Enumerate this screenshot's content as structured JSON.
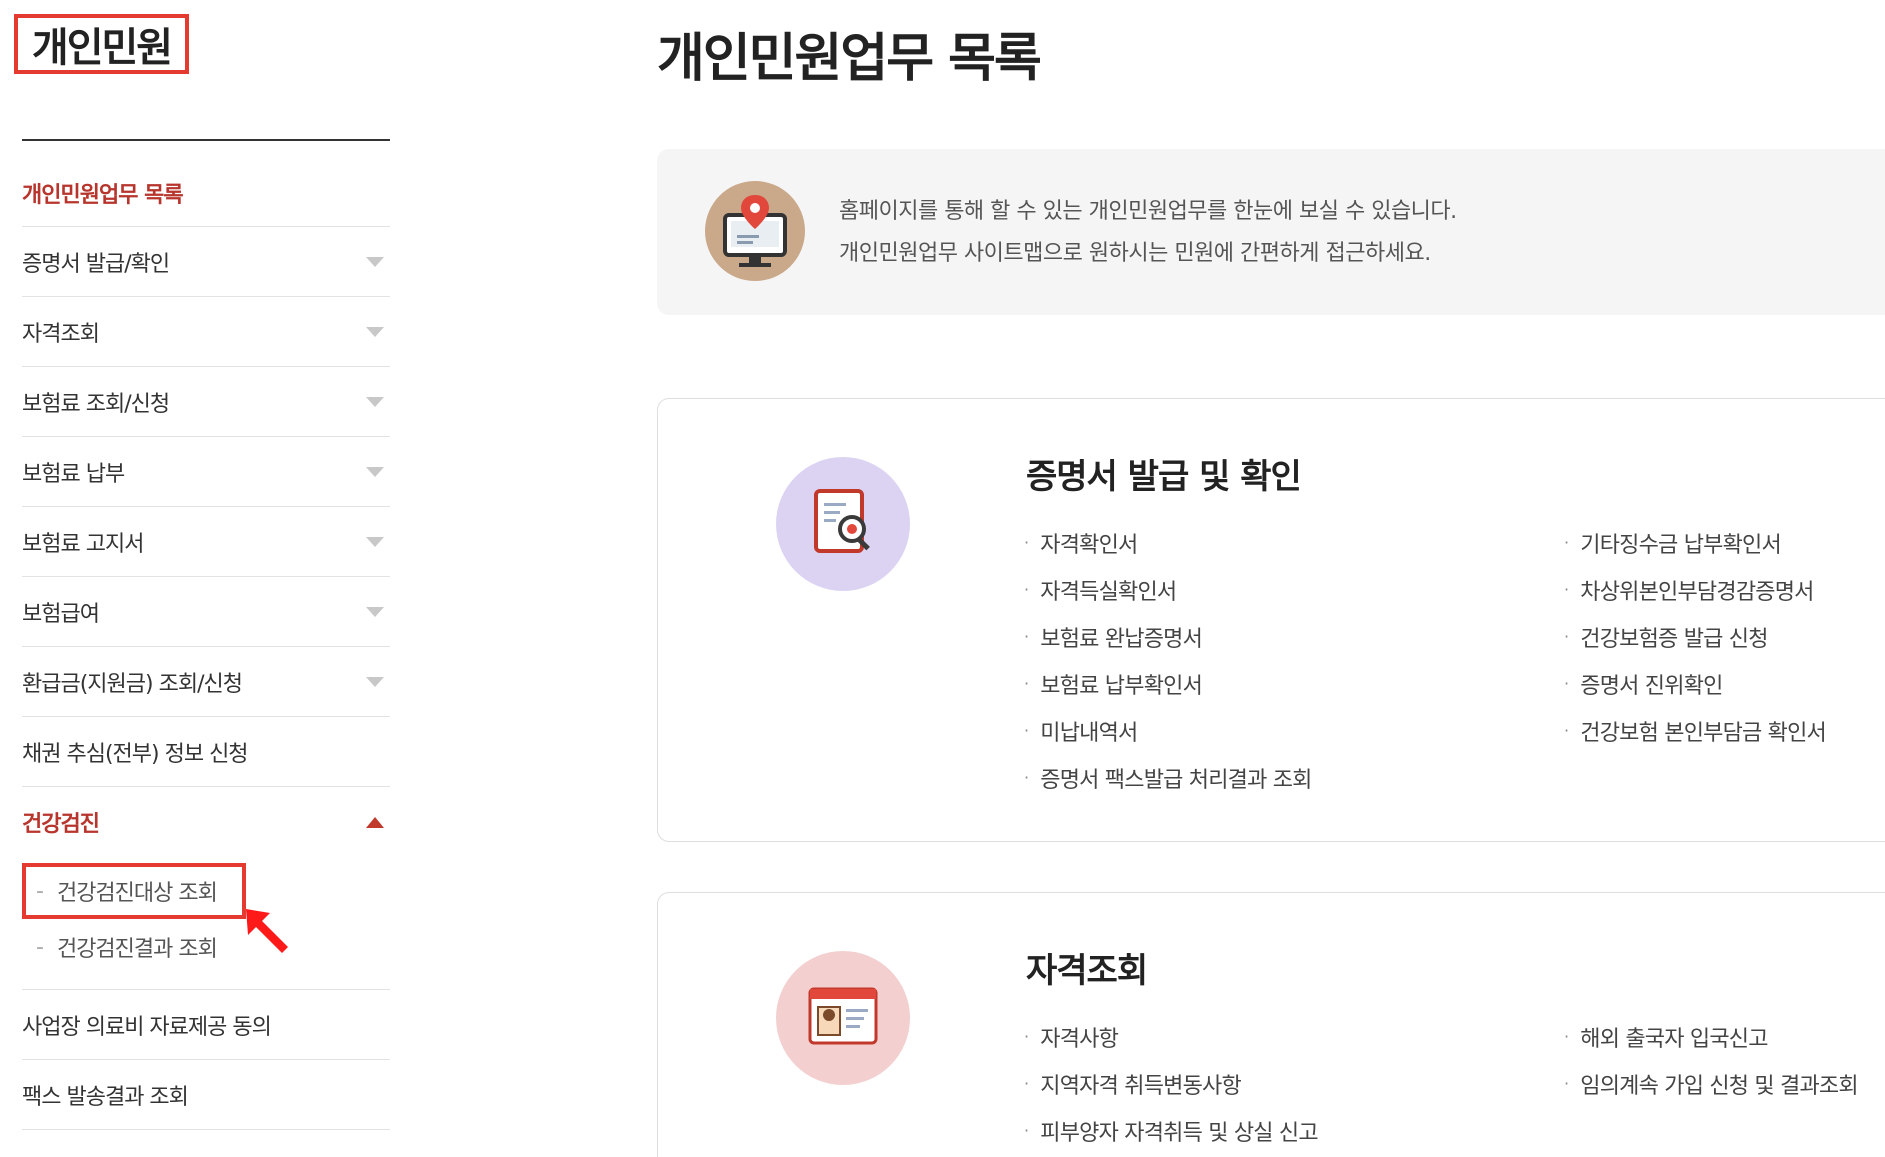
{
  "sidebar": {
    "title": "개인민원",
    "items": [
      {
        "label": "개인민원업무 목록"
      },
      {
        "label": "증명서 발급/확인"
      },
      {
        "label": "자격조회"
      },
      {
        "label": "보험료 조회/신청"
      },
      {
        "label": "보험료 납부"
      },
      {
        "label": "보험료 고지서"
      },
      {
        "label": "보험급여"
      },
      {
        "label": "환급금(지원금) 조회/신청"
      },
      {
        "label": "채권 추심(전부) 정보 신청"
      },
      {
        "label": "건강검진"
      },
      {
        "label": "사업장 의료비 자료제공 동의"
      },
      {
        "label": "팩스 발송결과 조회"
      }
    ],
    "submenu": [
      {
        "label": "건강검진대상 조회"
      },
      {
        "label": "건강검진결과 조회"
      }
    ]
  },
  "main": {
    "title": "개인민원업무 목록",
    "info": {
      "line1": "홈페이지를 통해 할 수 있는 개인민원업무를 한눈에 보실 수 있습니다.",
      "line2": "개인민원업무 사이트맵으로 원하시는 민원에 간편하게 접근하세요."
    },
    "sections": [
      {
        "title": "증명서 발급 및 확인",
        "col1": [
          "자격확인서",
          "자격득실확인서",
          "보험료 완납증명서",
          "보험료 납부확인서",
          "미납내역서",
          "증명서 팩스발급 처리결과 조회"
        ],
        "col2": [
          "기타징수금 납부확인서",
          "차상위본인부담경감증명서",
          "건강보험증 발급 신청",
          "증명서 진위확인",
          "건강보험 본인부담금 확인서"
        ]
      },
      {
        "title": "자격조회",
        "col1": [
          "자격사항",
          "지역자격 취득변동사항",
          "피부양자 자격취득 및 상실 신고"
        ],
        "col2": [
          "해외 출국자 입국신고",
          "임의계속 가입 신청 및 결과조회"
        ]
      }
    ]
  },
  "colors": {
    "accent": "#b7352c",
    "highlight_border": "#e53a2f"
  },
  "icons": [
    "caret-down-icon",
    "caret-up-icon",
    "monitor-pin-icon",
    "document-search-icon",
    "id-card-icon",
    "pointer-arrow-icon"
  ]
}
